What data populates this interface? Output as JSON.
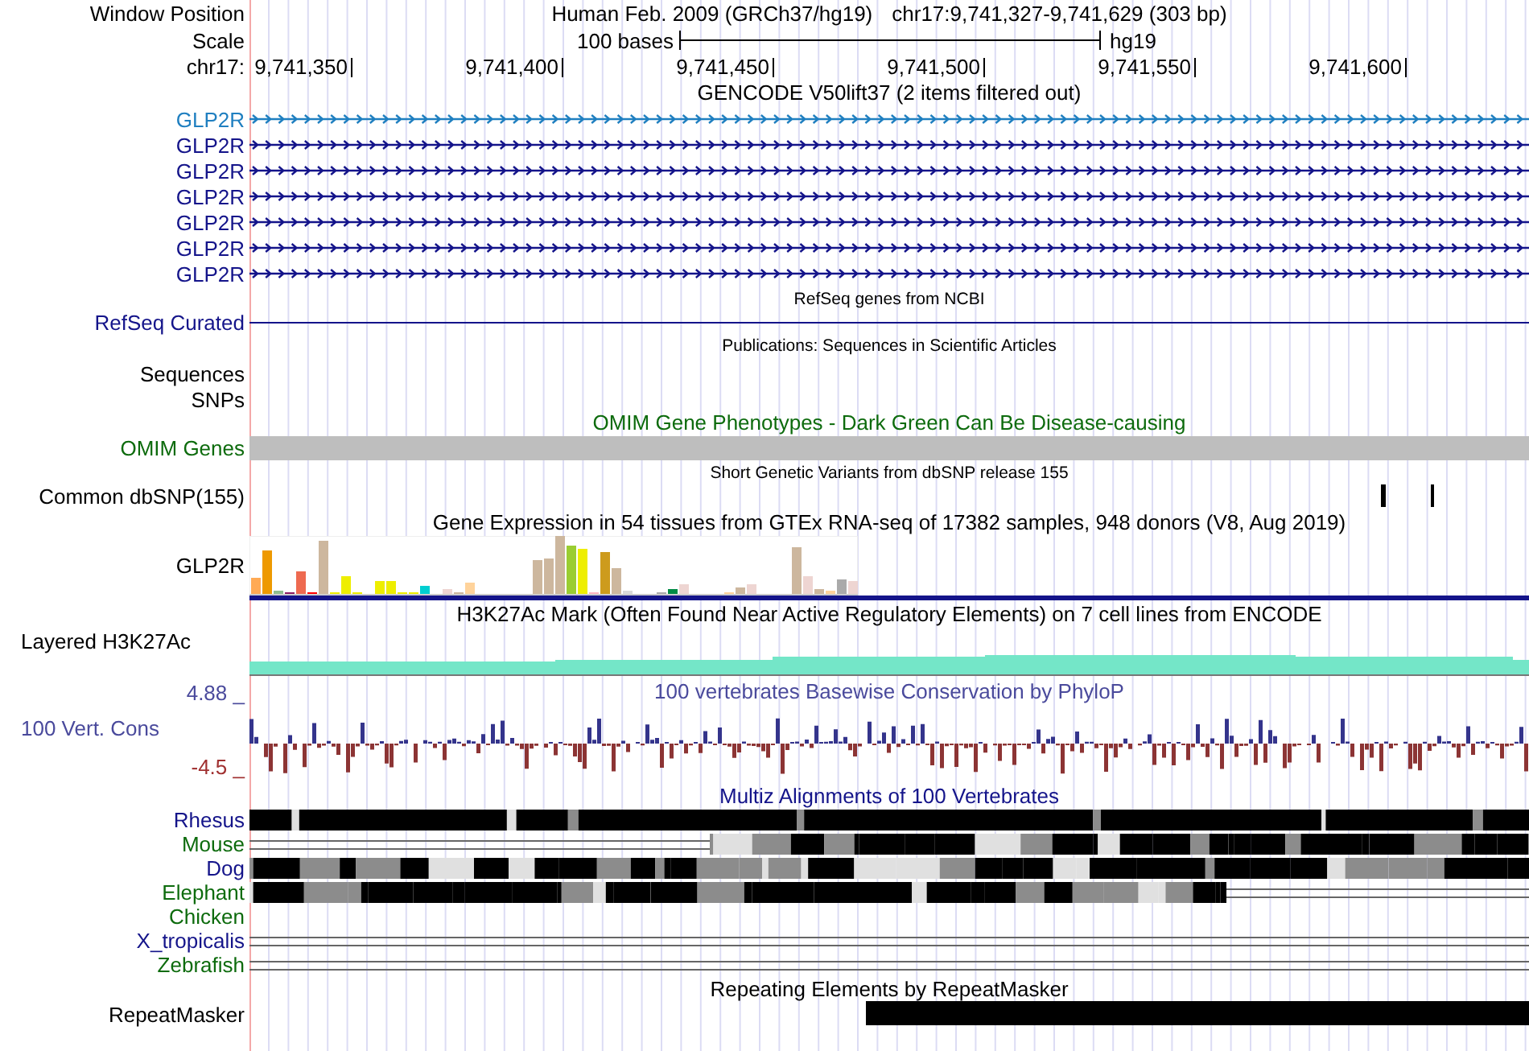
{
  "header": {
    "label": "Window Position",
    "assembly": "Human Feb. 2009 (GRCh37/hg19)",
    "position": "chr17:9,741,327-9,741,629 (303 bp)"
  },
  "scale": {
    "label": "Scale",
    "length": "100 bases",
    "db": "hg19"
  },
  "ruler": {
    "label": "chr17:",
    "ticks": [
      "9,741,350",
      "9,741,400",
      "9,741,450",
      "9,741,500",
      "9,741,550",
      "9,741,600"
    ]
  },
  "tracks": [
    {
      "kind": "gene",
      "title": "GENCODE V50lift37 (2 items filtered out)",
      "items": [
        {
          "label": "GLP2R",
          "color": "#1f7fc0"
        },
        {
          "label": "GLP2R",
          "color": "#14148a"
        },
        {
          "label": "GLP2R",
          "color": "#14148a"
        },
        {
          "label": "GLP2R",
          "color": "#14148a"
        },
        {
          "label": "GLP2R",
          "color": "#14148a"
        },
        {
          "label": "GLP2R",
          "color": "#14148a"
        },
        {
          "label": "GLP2R",
          "color": "#14148a"
        }
      ]
    },
    {
      "kind": "line",
      "title": "RefSeq genes from NCBI",
      "label": "RefSeq Curated"
    },
    {
      "kind": "empty",
      "title": "Publications: Sequences in Scientific Articles",
      "labels": [
        "Sequences",
        "SNPs"
      ]
    },
    {
      "kind": "bar",
      "title": "OMIM Gene Phenotypes - Dark Green Can Be Disease-causing",
      "label": "OMIM Genes"
    },
    {
      "kind": "snp",
      "title": "Short Genetic Variants from dbSNP release 155",
      "label": "Common dbSNP(155)"
    },
    {
      "kind": "expression",
      "title": "Gene Expression in 54 tissues from GTEx RNA-seq of 17382 samples, 948 donors (V8, Aug 2019)",
      "label": "GLP2R"
    },
    {
      "kind": "signal",
      "title": "H3K27Ac Mark (Often Found Near Active Regulatory Elements) on 7 cell lines from ENCODE",
      "label": "Layered H3K27Ac"
    },
    {
      "kind": "conservation",
      "title": "100 vertebrates Basewise Conservation by PhyloP",
      "label": "100 Vert. Cons",
      "max": "4.88 _",
      "min": "-4.5 _"
    },
    {
      "kind": "multiz",
      "title": "Multiz Alignments of 100 Vertebrates",
      "species": [
        {
          "name": "Rhesus",
          "color": "#14148a",
          "kind": "full"
        },
        {
          "name": "Mouse",
          "color": "#0d6b0d",
          "kind": "late"
        },
        {
          "name": "Dog",
          "color": "#14148a",
          "kind": "mixed"
        },
        {
          "name": "Elephant",
          "color": "#0d6b0d",
          "kind": "early"
        },
        {
          "name": "Chicken",
          "color": "#0d6b0d",
          "kind": "none"
        },
        {
          "name": "X_tropicalis",
          "color": "#14148a",
          "kind": "lines"
        },
        {
          "name": "Zebrafish",
          "color": "#0d6b0d",
          "kind": "lines"
        }
      ]
    },
    {
      "kind": "repeat",
      "title": "Repeating Elements by RepeatMasker",
      "label": "RepeatMasker"
    }
  ]
}
